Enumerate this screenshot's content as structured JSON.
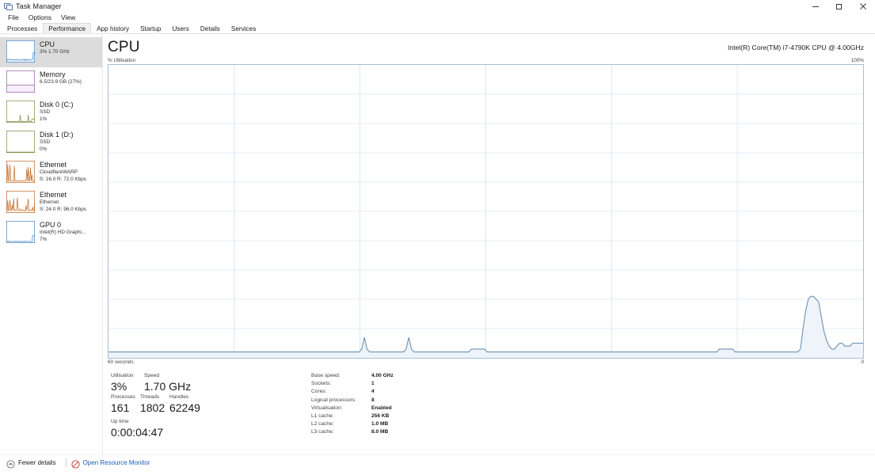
{
  "window": {
    "title": "Task Manager",
    "icon": "task-manager-icon",
    "controls": {
      "minimize": "Minimize",
      "restore": "Restore",
      "close": "Close"
    }
  },
  "menu": {
    "items": [
      "File",
      "Options",
      "View"
    ]
  },
  "tabs": {
    "items": [
      "Processes",
      "Performance",
      "App history",
      "Startup",
      "Users",
      "Details",
      "Services"
    ],
    "active": "Performance"
  },
  "sidebar": {
    "items": [
      {
        "title": "CPU",
        "sub1": "3% 1.70 GHz",
        "sub2": "",
        "color": "#4a86c5",
        "fill": "#e8f2fb",
        "selected": true,
        "graph": "cpu"
      },
      {
        "title": "Memory",
        "sub1": "6.5/23.9 GB (27%)",
        "sub2": "",
        "color": "#9b5fa8",
        "fill": "#f6eefa",
        "selected": false,
        "graph": "memory"
      },
      {
        "title": "Disk 0 (C:)",
        "sub1": "SSD",
        "sub2": "1%",
        "color": "#7a8f45",
        "fill": "#f4f7ea",
        "selected": false,
        "graph": "disk0"
      },
      {
        "title": "Disk 1 (D:)",
        "sub1": "SSD",
        "sub2": "0%",
        "color": "#7a8f45",
        "fill": "#f7f9f0",
        "selected": false,
        "graph": "disk1"
      },
      {
        "title": "Ethernet",
        "sub1": "CloudflareWARP",
        "sub2": "S: 16.0 R: 72.0 Kbps",
        "color": "#c06a2a",
        "fill": "#fdf2e8",
        "selected": false,
        "graph": "eth1"
      },
      {
        "title": "Ethernet",
        "sub1": "Ethernet",
        "sub2": "S: 24.0 R: 96.0 Kbps",
        "color": "#c06a2a",
        "fill": "#fdf2e8",
        "selected": false,
        "graph": "eth2"
      },
      {
        "title": "GPU 0",
        "sub1": "Intel(R) HD Graphi...",
        "sub2": "7%",
        "color": "#4a86c5",
        "fill": "#eef5fc",
        "selected": false,
        "graph": "gpu"
      }
    ]
  },
  "main": {
    "title": "CPU",
    "model": "Intel(R) Core(TM) i7-4790K CPU @ 4.00GHz",
    "y_axis_label": "% Utilisation",
    "y_max_label": "100%",
    "x_axis_label": "60 seconds",
    "x_end_label": "0"
  },
  "stats": {
    "utilisation_label": "Utilisation",
    "utilisation_value": "3%",
    "speed_label": "Speed",
    "speed_value": "1.70 GHz",
    "processes_label": "Processes",
    "processes_value": "161",
    "threads_label": "Threads",
    "threads_value": "1802",
    "handles_label": "Handles",
    "handles_value": "62249",
    "uptime_label": "Up time",
    "uptime_value": "0:00:04:47",
    "details": [
      {
        "key": "Base speed:",
        "value": "4.00 GHz"
      },
      {
        "key": "Sockets:",
        "value": "1"
      },
      {
        "key": "Cores:",
        "value": "4"
      },
      {
        "key": "Logical processors:",
        "value": "8"
      },
      {
        "key": "Virtualisation:",
        "value": "Enabled"
      },
      {
        "key": "L1 cache:",
        "value": "256 KB"
      },
      {
        "key": "L2 cache:",
        "value": "1.0 MB"
      },
      {
        "key": "L3 cache:",
        "value": "8.0 MB"
      }
    ]
  },
  "statusbar": {
    "fewer_details": "Fewer details",
    "resource_monitor": "Open Resource Monitor"
  },
  "chart_data": {
    "type": "area",
    "title": "CPU",
    "subtitle": "% Utilisation",
    "xlabel": "60 seconds",
    "ylabel": "% Utilisation",
    "ylim": [
      0,
      100
    ],
    "xlim": [
      60,
      0
    ],
    "grid": true,
    "line_color": "#6a92b5",
    "fill_color": "#eef4fa",
    "series": [
      {
        "name": "CPU utilisation",
        "values": [
          2,
          2,
          2,
          2,
          2,
          2,
          2,
          2,
          2,
          2,
          2,
          2,
          2,
          2,
          2,
          2,
          2,
          2,
          2,
          2,
          2,
          2,
          2,
          2,
          2,
          2,
          2,
          2,
          2,
          2,
          2,
          2,
          2,
          2,
          2,
          2,
          2,
          2,
          2,
          2,
          2,
          2,
          2,
          2,
          2,
          2,
          2,
          2,
          2,
          2,
          2,
          2,
          2,
          2,
          2,
          2,
          2,
          2,
          2,
          2,
          2,
          2,
          2,
          2,
          2,
          2,
          2,
          2,
          2,
          2,
          2,
          2,
          2,
          2,
          2,
          2,
          2,
          2,
          2,
          2,
          2,
          2,
          2,
          2,
          2,
          2,
          2,
          2,
          2,
          2,
          2,
          2,
          2,
          2,
          2,
          2,
          2,
          3,
          7,
          3,
          2,
          2,
          2,
          2,
          2,
          2,
          2,
          2,
          2,
          2,
          2,
          2,
          2,
          2,
          3,
          7,
          3,
          2,
          2,
          2,
          2,
          2,
          2,
          2,
          2,
          2,
          2,
          2,
          2,
          2,
          2,
          2,
          2,
          2,
          2,
          2,
          2,
          2,
          2,
          3,
          3,
          3,
          3,
          3,
          3,
          2,
          2,
          2,
          2,
          2,
          2,
          2,
          2,
          2,
          2,
          2,
          2,
          2,
          2,
          2,
          2,
          2,
          2,
          2,
          2,
          2,
          2,
          2,
          2,
          2,
          2,
          2,
          2,
          2,
          2,
          2,
          2,
          2,
          2,
          2,
          2,
          2,
          2,
          2,
          2,
          2,
          2,
          2,
          2,
          2,
          2,
          2,
          2,
          2,
          2,
          2,
          2,
          2,
          2,
          2,
          2,
          2,
          2,
          2,
          2,
          2,
          2,
          2,
          2,
          2,
          2,
          2,
          2,
          2,
          2,
          2,
          2,
          2,
          2,
          2,
          2,
          2,
          2,
          2,
          2,
          2,
          2,
          2,
          2,
          2,
          2,
          2,
          2,
          2,
          3,
          3,
          3,
          3,
          3,
          3,
          2,
          2,
          2,
          2,
          2,
          2,
          2,
          2,
          2,
          2,
          2,
          2,
          2,
          2,
          2,
          2,
          2,
          2,
          2,
          2,
          2,
          2,
          2,
          2,
          2,
          3,
          10,
          16,
          20,
          21,
          21,
          20,
          19,
          14,
          9,
          6,
          4,
          3,
          3,
          4,
          5,
          5,
          4,
          4,
          4,
          5,
          5,
          5,
          5,
          5
        ]
      }
    ]
  }
}
